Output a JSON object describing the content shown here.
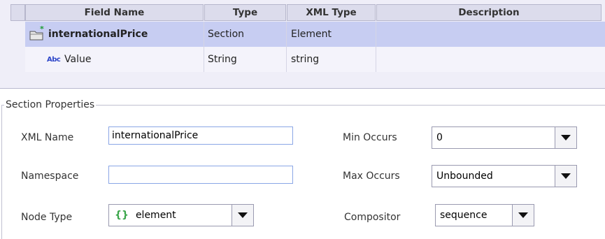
{
  "grid": {
    "columns": [
      "Field Name",
      "Type",
      "XML Type",
      "Description"
    ],
    "rows": [
      {
        "field_name": "internationalPrice",
        "type": "Section",
        "xml_type": "Element",
        "description": "",
        "icon": "section-folder-icon",
        "selected": true
      },
      {
        "field_name": "Value",
        "type": "String",
        "xml_type": "string",
        "description": "",
        "icon": "abc-string-icon",
        "icon_text": "Abc",
        "selected": false
      }
    ]
  },
  "section_properties": {
    "title": "Section Properties",
    "xml_name": {
      "label": "XML Name",
      "value": "internationalPrice"
    },
    "namespace": {
      "label": "Namespace",
      "value": ""
    },
    "node_type": {
      "label": "Node Type",
      "value": "element",
      "icon": "braces-icon"
    },
    "min_occurs": {
      "label": "Min Occurs",
      "value": "0"
    },
    "max_occurs": {
      "label": "Max Occurs",
      "value": "Unbounded"
    },
    "compositor": {
      "label": "Compositor",
      "value": "sequence"
    }
  },
  "colors": {
    "selected_row": "#c7cdf2",
    "header_bg": "#dcdcec",
    "input_border": "#8aa6e6",
    "braces_icon": "#3aa64a"
  }
}
